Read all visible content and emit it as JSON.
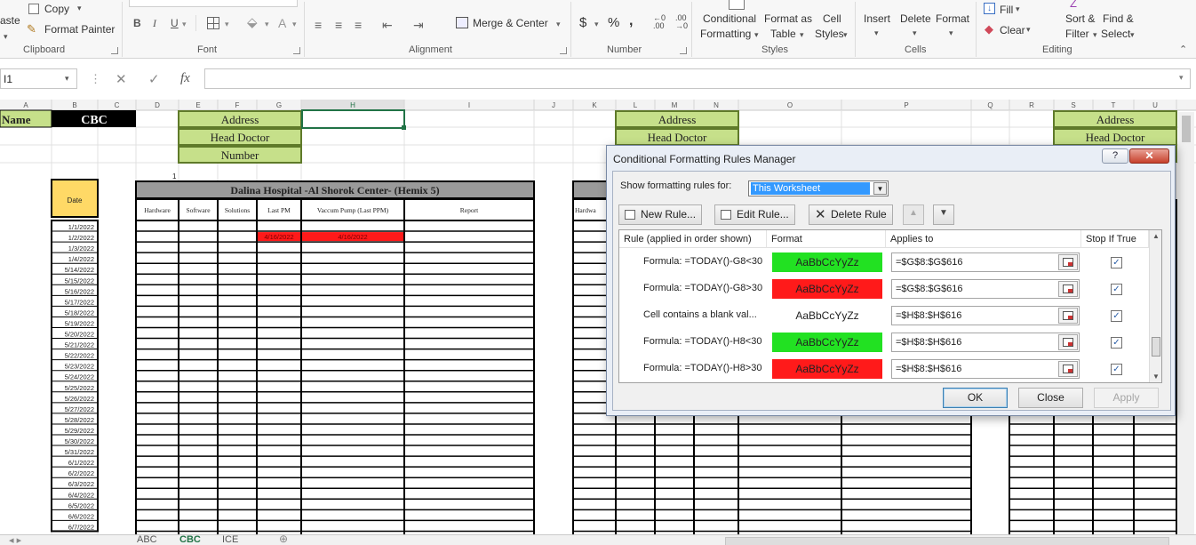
{
  "ribbon": {
    "paste_label": "aste",
    "copy_label": "Copy",
    "format_painter_label": "Format Painter",
    "clipboard_group": "Clipboard",
    "font_group": "Font",
    "bold": "B",
    "italic": "I",
    "underline": "U",
    "merge_center": "Merge & Center",
    "alignment_group": "Alignment",
    "currency": "$",
    "percent": "%",
    "comma": ",",
    "number_group": "Number",
    "conditional_formatting_1": "Conditional",
    "conditional_formatting_2": "Formatting",
    "format_as_1": "Format as",
    "format_as_2": "Table",
    "cell_styles_1": "Cell",
    "cell_styles_2": "Styles",
    "styles_group": "Styles",
    "insert": "Insert",
    "delete": "Delete",
    "format": "Format",
    "cells_group": "Cells",
    "fill": "Fill",
    "clear": "Clear",
    "sort_filter_1": "Sort &",
    "sort_filter_2": "Filter",
    "find_select_1": "Find &",
    "find_select_2": "Select",
    "editing_group": "Editing"
  },
  "formula_bar": {
    "name_box": "I1",
    "cancel_icon": "✕",
    "enter_icon": "✓",
    "fx": "fx",
    "value": ""
  },
  "grid": {
    "columns": [
      "A",
      "B",
      "C",
      "D",
      "E",
      "F",
      "G",
      "H",
      "I",
      "J",
      "K",
      "L",
      "M",
      "N",
      "O",
      "P",
      "Q",
      "R",
      "S",
      "T",
      "U"
    ],
    "name_label": "Name",
    "cbc_label": "CBC",
    "address": "Address",
    "head_doctor": "Head Doctor",
    "number": "Number",
    "row_marker": "1",
    "banner": "Dalina Hospital -Al Shorok Center- (Hemix 5)",
    "date_header": "Date",
    "table_headers": [
      "Hardware",
      "Software",
      "Solutions",
      "Last PM",
      "Vaccum Pump (Last PPM)",
      "Report"
    ],
    "hardware_trunc": "Hardwa",
    "red_cell_values": [
      "4/16/2022",
      "4/16/2022"
    ],
    "dates": [
      "1/1/2022",
      "1/2/2022",
      "1/3/2022",
      "1/4/2022",
      "5/14/2022",
      "5/15/2022",
      "5/16/2022",
      "5/17/2022",
      "5/18/2022",
      "5/19/2022",
      "5/20/2022",
      "5/21/2022",
      "5/22/2022",
      "5/23/2022",
      "5/24/2022",
      "5/25/2022",
      "5/26/2022",
      "5/27/2022",
      "5/28/2022",
      "5/29/2022",
      "5/30/2022",
      "5/31/2022",
      "6/1/2022",
      "6/2/2022",
      "6/3/2022",
      "6/4/2022",
      "6/5/2022",
      "6/6/2022",
      "6/7/2022"
    ]
  },
  "sheet_tabs": [
    "ABC",
    "CBC",
    "ICE"
  ],
  "dialog": {
    "title": "Conditional Formatting Rules Manager",
    "help": "?",
    "close": "✕",
    "show_rules_label": "Show formatting rules for:",
    "show_rules_value": "This Worksheet",
    "new_rule": "New Rule...",
    "edit_rule": "Edit Rule...",
    "delete_rule": "Delete Rule",
    "col_rule": "Rule (applied in order shown)",
    "col_format": "Format",
    "col_applies": "Applies to",
    "col_stop": "Stop If True",
    "rules": [
      {
        "rule": "Formula: =TODAY()-G8<30",
        "preview": "AaBbCcYyZz",
        "fill": "#22e122",
        "applies": "=$G$8:$G$616",
        "stop": true
      },
      {
        "rule": "Formula: =TODAY()-G8>30",
        "preview": "AaBbCcYyZz",
        "fill": "#ff1a1a",
        "applies": "=$G$8:$G$616",
        "stop": true
      },
      {
        "rule": "Cell contains a blank val...",
        "preview": "AaBbCcYyZz",
        "fill": "#ffffff",
        "applies": "=$H$8:$H$616",
        "stop": true
      },
      {
        "rule": "Formula: =TODAY()-H8<30",
        "preview": "AaBbCcYyZz",
        "fill": "#22e122",
        "applies": "=$H$8:$H$616",
        "stop": true
      },
      {
        "rule": "Formula: =TODAY()-H8>30",
        "preview": "AaBbCcYyZz",
        "fill": "#ff1a1a",
        "applies": "=$H$8:$H$616",
        "stop": true
      }
    ],
    "ok": "OK",
    "close_button": "Close",
    "apply_button": "Apply"
  },
  "colors": {
    "green_label": "#c6e08a",
    "green_label_border": "#5f7a2a",
    "red_fill": "#ff1a1a",
    "green_fill": "#22e122",
    "date_header_fill": "#ffd966",
    "banner_fill": "#9a9a9a"
  }
}
